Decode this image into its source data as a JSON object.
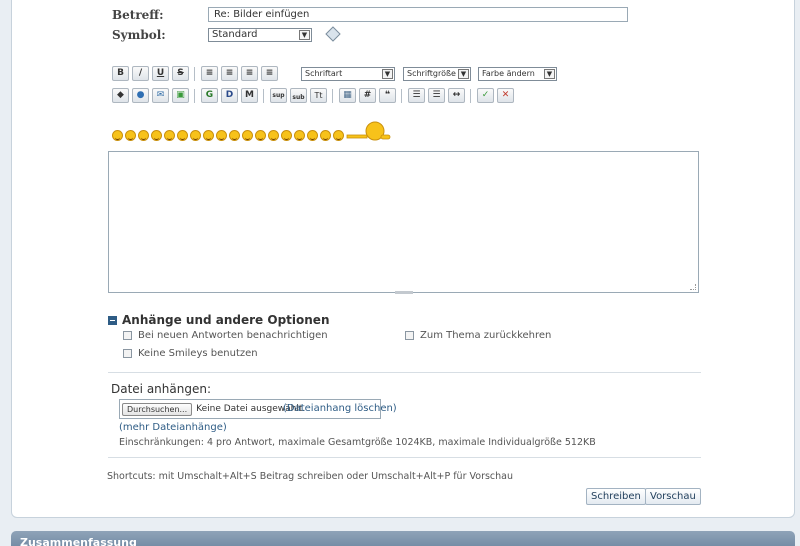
{
  "form": {
    "subject_label": "Betreff:",
    "subject_value": "Re: Bilder einfügen",
    "symbol_label": "Symbol:",
    "symbol_value": "Standard"
  },
  "toolbar": {
    "font_select": "Schriftart",
    "size_select": "Schriftgröße",
    "color_select": "Farbe ändern",
    "btn_bold": "B",
    "btn_italic": "/",
    "btn_underline": "U",
    "btn_strike": "S",
    "btn_g": "G",
    "btn_d": "D",
    "btn_m": "M",
    "btn_sup": "sup",
    "btn_sub": "sub",
    "btn_tt": "Tt",
    "btn_hash": "#"
  },
  "options": {
    "title": "Anhänge und andere Optionen",
    "notify": "Bei neuen Antworten benachrichtigen",
    "return_topic": "Zum Thema zurückkehren",
    "no_smileys": "Keine Smileys benutzen"
  },
  "attach": {
    "title": "Datei anhängen:",
    "browse": "Durchsuchen...",
    "no_file": "Keine Datei ausgewählt.",
    "delete": "(Dateianhang löschen)",
    "more": "(mehr Dateianhänge)",
    "limits": "Einschränkungen: 4 pro Antwort, maximale Gesamtgröße 1024KB, maximale Individualgröße 512KB"
  },
  "shortcuts": "Shortcuts: mit Umschalt+Alt+S Beitrag schreiben oder Umschalt+Alt+P für Vorschau",
  "buttons": {
    "submit": "Schreiben",
    "preview": "Vorschau"
  },
  "footer": {
    "title": "Zusammenfassung"
  },
  "icons": [
    "bold-icon",
    "italic-icon",
    "underline-icon",
    "strike-icon",
    "align-left-icon",
    "align-center-icon",
    "align-right-icon",
    "justify-icon",
    "smiley-icon",
    "pointer-smiley-icon"
  ]
}
